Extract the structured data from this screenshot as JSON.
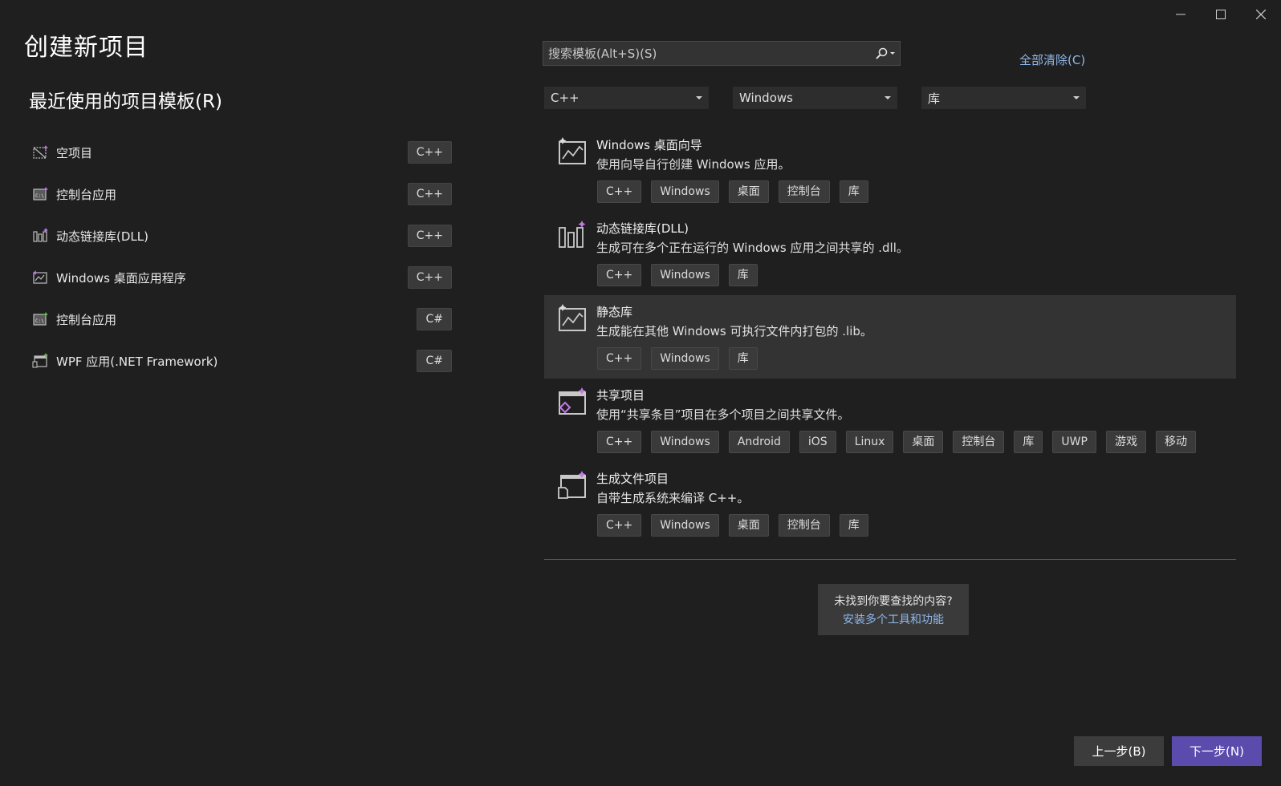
{
  "window": {
    "title": "创建新项目"
  },
  "recent": {
    "heading": "最近使用的项目模板(R)",
    "items": [
      {
        "label": "空项目",
        "lang": "C++",
        "icon": "empty-project-icon"
      },
      {
        "label": "控制台应用",
        "lang": "C++",
        "icon": "console-app-icon"
      },
      {
        "label": "动态链接库(DLL)",
        "lang": "C++",
        "icon": "dll-icon"
      },
      {
        "label": "Windows 桌面应用程序",
        "lang": "C++",
        "icon": "desktop-app-icon"
      },
      {
        "label": "控制台应用",
        "lang": "C#",
        "icon": "console-app-icon"
      },
      {
        "label": "WPF 应用(.NET Framework)",
        "lang": "C#",
        "icon": "wpf-app-icon"
      }
    ]
  },
  "search": {
    "placeholder": "搜索模板(Alt+S)(S)"
  },
  "clear_all": "全部清除(C)",
  "filters": {
    "language": "C++",
    "platform": "Windows",
    "project_type": "库"
  },
  "templates": [
    {
      "name": "Windows 桌面向导",
      "desc": "使用向导自行创建 Windows 应用。",
      "tags": [
        "C++",
        "Windows",
        "桌面",
        "控制台",
        "库"
      ],
      "selected": false
    },
    {
      "name": "动态链接库(DLL)",
      "desc": "生成可在多个正在运行的 Windows 应用之间共享的 .dll。",
      "tags": [
        "C++",
        "Windows",
        "库"
      ],
      "selected": false
    },
    {
      "name": "静态库",
      "desc": "生成能在其他 Windows 可执行文件内打包的 .lib。",
      "tags": [
        "C++",
        "Windows",
        "库"
      ],
      "selected": true
    },
    {
      "name": "共享项目",
      "desc": "使用“共享条目”项目在多个项目之间共享文件。",
      "tags": [
        "C++",
        "Windows",
        "Android",
        "iOS",
        "Linux",
        "桌面",
        "控制台",
        "库",
        "UWP",
        "游戏",
        "移动"
      ],
      "selected": false
    },
    {
      "name": "生成文件项目",
      "desc": "自带生成系统来编译 C++。",
      "tags": [
        "C++",
        "Windows",
        "桌面",
        "控制台",
        "库"
      ],
      "selected": false
    }
  ],
  "not_found": {
    "question": "未找到你要查找的内容?",
    "link": "安装多个工具和功能"
  },
  "buttons": {
    "back": "上一步(B)",
    "next": "下一步(N)"
  },
  "colors": {
    "background": "#1f1f1f",
    "accent": "#5b4bad",
    "link": "#8fb8ec",
    "selected_row": "#333333"
  }
}
